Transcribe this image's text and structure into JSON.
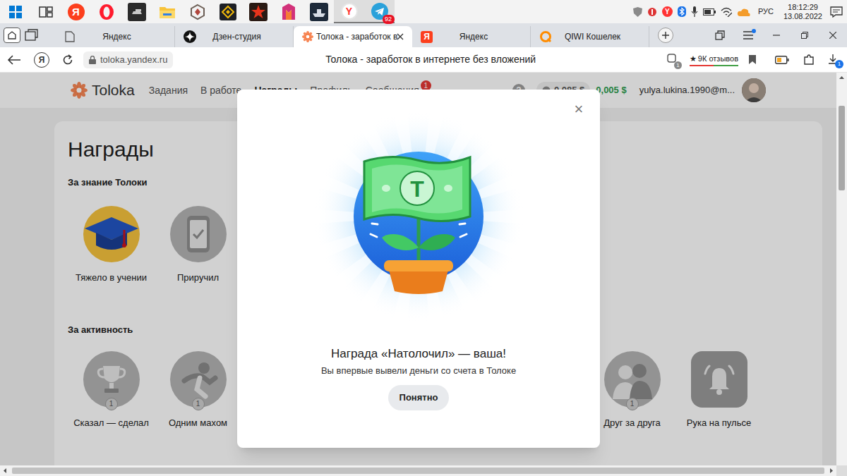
{
  "taskbar": {
    "apps": [
      {
        "kind": "start",
        "active": false
      },
      {
        "kind": "taskview",
        "active": false
      },
      {
        "kind": "yandex",
        "glyph": "Я",
        "active": false
      },
      {
        "kind": "opera",
        "active": false
      },
      {
        "kind": "tanks",
        "active": false
      },
      {
        "kind": "folder",
        "active": false
      },
      {
        "kind": "hex",
        "active": false
      },
      {
        "kind": "binance",
        "active": false
      },
      {
        "kind": "star",
        "active": false
      },
      {
        "kind": "game",
        "active": false
      },
      {
        "kind": "ships",
        "active": false
      },
      {
        "kind": "browser",
        "glyph": "Y",
        "active": true
      },
      {
        "kind": "telegram",
        "badge": "92",
        "active": true
      }
    ],
    "tray": {
      "glyph": "Y",
      "lang": "РУС",
      "time": "18:12:29",
      "date": "13.08.2022"
    }
  },
  "tabs": [
    {
      "label": "Яндекс",
      "kind": "doc",
      "selected": false
    },
    {
      "label": "Дзен-студия",
      "kind": "zen",
      "selected": false
    },
    {
      "label": "Толока - заработок в",
      "kind": "toloka",
      "selected": true
    },
    {
      "label": "Яндекс",
      "kind": "yandex",
      "glyph": "Я",
      "selected": false
    },
    {
      "label": "QIWI Кошелек",
      "kind": "qiwi",
      "selected": false
    }
  ],
  "address_bar": {
    "glyph": "Я",
    "url": "toloka.yandex.ru",
    "title": "Толока - заработок в интернете без вложений",
    "extension_badge": "1",
    "rating": {
      "star": "★",
      "label": "9К отзывов"
    },
    "downloads_badge": "1"
  },
  "page": {
    "logo": "Toloka",
    "nav": [
      {
        "label": "Задания",
        "selected": false
      },
      {
        "label": "В работе",
        "selected": false
      },
      {
        "label": "Награды",
        "selected": true
      },
      {
        "label": "Профиль",
        "selected": false
      },
      {
        "label": "Сообщения",
        "selected": false,
        "badge": "1"
      }
    ],
    "help": "?",
    "balance": "0,085 $",
    "earnings": "0,005 $",
    "email": "yulya.lukina.1990@m...",
    "title": "Награды",
    "sections": [
      {
        "title": "За знание Толоки",
        "left": [
          {
            "label": "Тяжело в учении",
            "kind": "cap",
            "earned": true
          },
          {
            "label": "Приручил",
            "kind": "phone",
            "earned": false
          }
        ],
        "right": []
      },
      {
        "title": "За активность",
        "left": [
          {
            "label": "Сказал — сделал",
            "kind": "trophy",
            "earned": false,
            "medal": "1"
          },
          {
            "label": "Одним махом",
            "kind": "runner",
            "earned": false,
            "medal": "1"
          }
        ],
        "right": [
          {
            "label": "Друг за друга",
            "kind": "friends",
            "earned": false,
            "medal": "1"
          },
          {
            "label": "Рука на пульсе",
            "kind": "bell",
            "earned": false
          }
        ]
      }
    ]
  },
  "modal": {
    "close": "×",
    "note_letter": "T",
    "title": "Награда «Натолочил» — ваша!",
    "text": "Вы впервые вывели деньги со счета в Толоке",
    "button": "Понятно"
  }
}
